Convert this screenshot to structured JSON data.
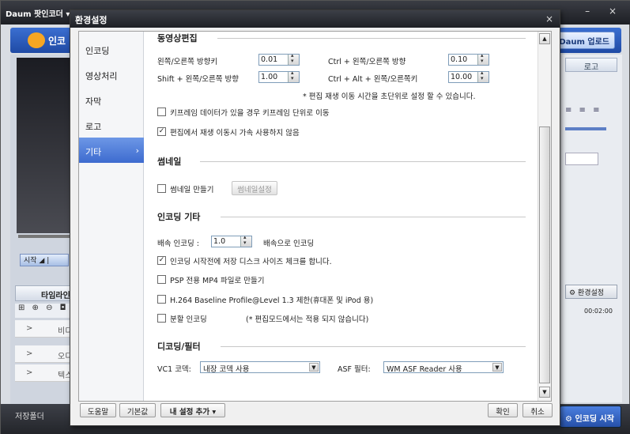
{
  "app": {
    "title": "Daum 팟인코더 ▾",
    "window_controls": "– ×",
    "logo_text": "인코",
    "daum_upload": "Daum 업로드",
    "start_label": "시작 ◢ |",
    "timeline_label": "타임라인",
    "timeline_tools": "⊞ ⊕ ⊖ ◘",
    "tracks": [
      {
        "arrow": ">",
        "label": "비디"
      },
      {
        "arrow": ">",
        "label": "오디"
      },
      {
        "arrow": ">",
        "label": "텍스"
      }
    ],
    "save_folder": "저장폴더",
    "encode_start": "⚙ 인코딩 시작",
    "logo_tab": "로고",
    "align_buttons": "≡ ≡ ≡",
    "env_settings": "⚙ 환경설정",
    "time_label": "00:02:00"
  },
  "dialog": {
    "title": "환경설정",
    "close": "×",
    "nav": [
      {
        "label": "인코딩",
        "active": false
      },
      {
        "label": "영상처리",
        "active": false
      },
      {
        "label": "자막",
        "active": false
      },
      {
        "label": "로고",
        "active": false
      },
      {
        "label": "기타",
        "active": true
      }
    ],
    "nav_chevron": "›",
    "video_edit": {
      "heading": "동영상편집",
      "left_right_key": "왼쪽/오른쪽 방향키",
      "left_right_value": "0.01",
      "ctrl_left_right": "Ctrl + 왼쪽/오른쪽 방향",
      "ctrl_left_right_value": "0.10",
      "shift_left_right": "Shift + 왼쪽/오른쪽 방향",
      "shift_left_right_value": "1.00",
      "ctrl_alt_left_right": "Ctrl + Alt + 왼쪽/오른쪽키",
      "ctrl_alt_left_right_value": "10.00",
      "note": "* 편집 재생 이동 시간을 초단위로 설정 할 수 있습니다.",
      "keyframe_label": "키프레임 데이터가 있을 경우 키프레임 단위로 이동",
      "keyframe_checked": false,
      "no_accel_label": "편집에서 재생 이동시 가속 사용하지 않음",
      "no_accel_checked": true
    },
    "thumbnail": {
      "heading": "썸네일",
      "create_label": "썸네일 만들기",
      "create_checked": false,
      "settings_button": "썸네일설정"
    },
    "encoding_misc": {
      "heading": "인코딩 기타",
      "speed_label": "배속 인코딩 :",
      "speed_value": "1.0",
      "speed_suffix": "배속으로 인코딩",
      "disk_check_label": "인코딩 시작전에 저장 디스크 사이즈 체크를 합니다.",
      "disk_check_checked": true,
      "psp_label": "PSP 전용 MP4 파일로 만들기",
      "psp_checked": false,
      "h264_label": "H.264 Baseline Profile@Level 1.3 제한(휴대폰 및 iPod 용)",
      "h264_checked": false,
      "split_label": "분할 인코딩",
      "split_checked": false,
      "split_note": "(* 편집모드에서는 적용 되지 않습니다)"
    },
    "decoding": {
      "heading": "디코딩/필터",
      "vc1_label": "VC1 코덱:",
      "vc1_value": "내장 코덱 사용",
      "asf_label": "ASF 필터:",
      "asf_value": "WM ASF Reader  사용"
    },
    "scroll": {
      "up": "▲",
      "down": "▼"
    },
    "footer": {
      "help": "도움말",
      "default": "기본값",
      "my_settings": "내 설정 추가 ▾",
      "ok": "확인",
      "cancel": "취소"
    }
  }
}
